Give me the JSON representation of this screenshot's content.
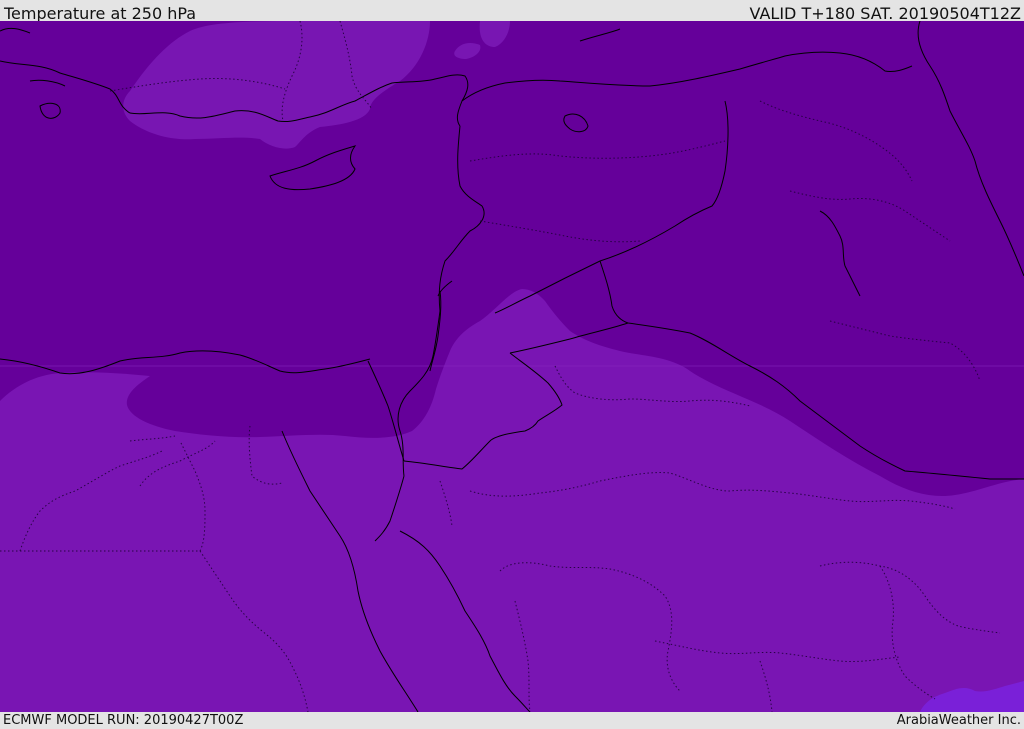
{
  "header": {
    "title": "Temperature at 250 hPa",
    "valid": "VALID T+180 SAT. 20190504T12Z"
  },
  "footer": {
    "model_run": "ECMWF MODEL RUN: 20190427T00Z",
    "credit": "ArabiaWeather Inc."
  },
  "map": {
    "field": "temperature-250hPa",
    "colors": {
      "cold_band": "#65009a",
      "mid_band": "#7a14b4",
      "light_band": "#7816b2",
      "warm_patch": "#7a20d8",
      "coastline": "#000000",
      "frame_bg": "#e4e4e4"
    }
  }
}
